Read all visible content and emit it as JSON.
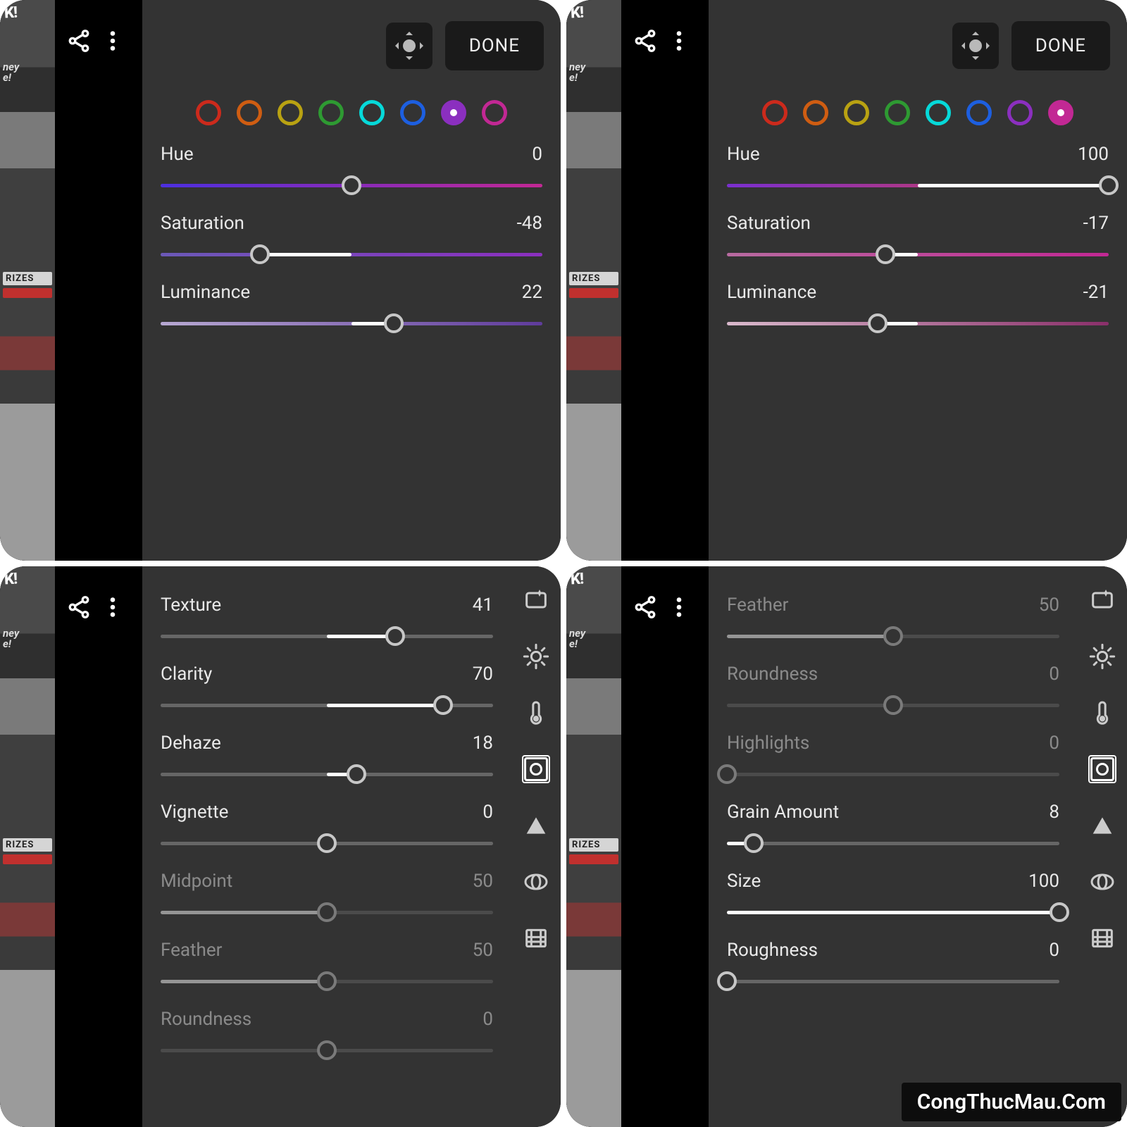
{
  "topbar": {
    "done": "DONE"
  },
  "watermark": "CongThucMau.Com",
  "colors": [
    {
      "name": "red",
      "hex": "#cc2a1c"
    },
    {
      "name": "orange",
      "hex": "#cf5d12"
    },
    {
      "name": "yellow",
      "hex": "#b9a212"
    },
    {
      "name": "green",
      "hex": "#2e9a32"
    },
    {
      "name": "aqua",
      "hex": "#06d9d9"
    },
    {
      "name": "blue",
      "hex": "#1d5fe0"
    },
    {
      "name": "purple",
      "hex": "#8b2fbf"
    },
    {
      "name": "magenta",
      "hex": "#c22894"
    }
  ],
  "panels": {
    "tl": {
      "selected_color_index": 6,
      "sliders": [
        {
          "label": "Hue",
          "value": 0,
          "min": -100,
          "max": 100,
          "type": "hue",
          "grad": [
            "#4c2fe0",
            "#c22894"
          ]
        },
        {
          "label": "Saturation",
          "value": -48,
          "min": -100,
          "max": 100,
          "type": "sat",
          "grad": [
            "#6b59b8",
            "#8b2fbf"
          ]
        },
        {
          "label": "Luminance",
          "value": 22,
          "min": -100,
          "max": 100,
          "type": "lum",
          "grad": [
            "#b7a8d2",
            "#5f3b9c"
          ]
        }
      ]
    },
    "tr": {
      "selected_color_index": 7,
      "sliders": [
        {
          "label": "Hue",
          "value": 100,
          "min": -100,
          "max": 100,
          "type": "hue",
          "grad": [
            "#7a2fd0",
            "#e04040"
          ]
        },
        {
          "label": "Saturation",
          "value": -17,
          "min": -100,
          "max": 100,
          "type": "sat",
          "grad": [
            "#b86aa0",
            "#c22894"
          ]
        },
        {
          "label": "Luminance",
          "value": -21,
          "min": -100,
          "max": 100,
          "type": "lum",
          "grad": [
            "#d9b9cc",
            "#8a2f6a"
          ]
        }
      ]
    },
    "bl": {
      "tool_selected": 3,
      "sliders": [
        {
          "label": "Texture",
          "value": 41,
          "min": -100,
          "max": 100,
          "type": "center",
          "dim": false
        },
        {
          "label": "Clarity",
          "value": 70,
          "min": -100,
          "max": 100,
          "type": "center",
          "dim": false
        },
        {
          "label": "Dehaze",
          "value": 18,
          "min": -100,
          "max": 100,
          "type": "center",
          "dim": false
        },
        {
          "label": "Vignette",
          "value": 0,
          "min": -100,
          "max": 100,
          "type": "center",
          "dim": false
        },
        {
          "label": "Midpoint",
          "value": 50,
          "min": 0,
          "max": 100,
          "type": "left",
          "dim": true
        },
        {
          "label": "Feather",
          "value": 50,
          "min": 0,
          "max": 100,
          "type": "left",
          "dim": true
        },
        {
          "label": "Roundness",
          "value": 0,
          "min": -100,
          "max": 100,
          "type": "center",
          "dim": true
        }
      ]
    },
    "br": {
      "tool_selected": 3,
      "sliders": [
        {
          "label": "Feather",
          "value": 50,
          "min": 0,
          "max": 100,
          "type": "left",
          "dim": true
        },
        {
          "label": "Roundness",
          "value": 0,
          "min": -100,
          "max": 100,
          "type": "center",
          "dim": true
        },
        {
          "label": "Highlights",
          "value": 0,
          "min": 0,
          "max": 100,
          "type": "left",
          "dim": true
        },
        {
          "label": "Grain Amount",
          "value": 8,
          "min": 0,
          "max": 100,
          "type": "left",
          "dim": false
        },
        {
          "label": "Size",
          "value": 100,
          "min": 0,
          "max": 100,
          "type": "left",
          "dim": false
        },
        {
          "label": "Roughness",
          "value": 0,
          "min": 0,
          "max": 100,
          "type": "left",
          "dim": false
        }
      ]
    }
  },
  "photo_strip": {
    "prizes_label": "RIZES",
    "xk": "K!",
    "hey": "ney\ne!"
  }
}
